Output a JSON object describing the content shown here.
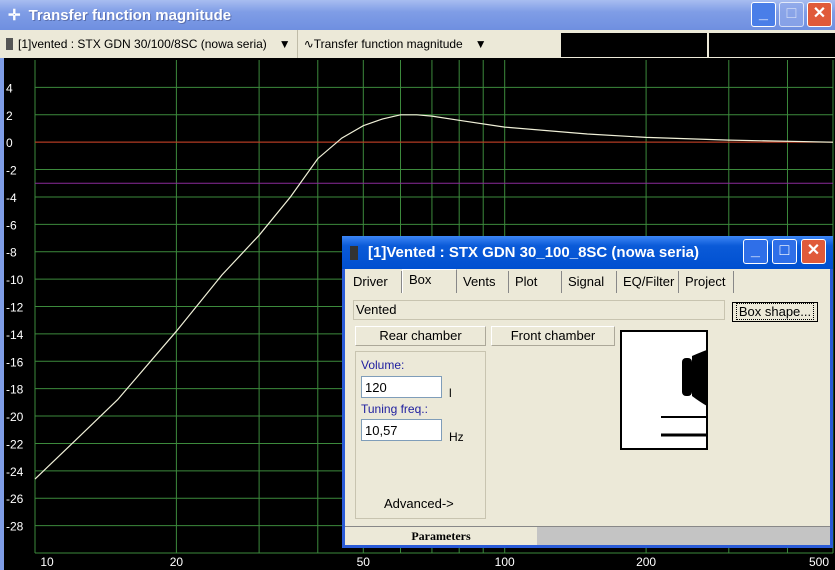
{
  "window": {
    "title": "Transfer function magnitude",
    "icon": "crosshair-icon"
  },
  "toolbar": {
    "project_select": "[1]vented : STX GDN 30/100/8SC (nowa seria)",
    "plot_select": "Transfer function magnitude"
  },
  "chart_data": {
    "type": "line",
    "title": "",
    "xlabel": "",
    "ylabel": "",
    "xscale": "log",
    "xlim": [
      10,
      500
    ],
    "ylim": [
      -30,
      6
    ],
    "grid": true,
    "x_ticks": [
      10,
      20,
      50,
      100,
      200,
      500
    ],
    "x_gridlines": [
      10,
      20,
      30,
      40,
      50,
      60,
      70,
      80,
      90,
      100,
      200,
      300,
      400,
      500
    ],
    "y_ticks": [
      4,
      2,
      0,
      -2,
      -4,
      -6,
      -8,
      -10,
      -12,
      -14,
      -16,
      -18,
      -20,
      -22,
      -24,
      -26,
      -28
    ],
    "reference_lines": [
      {
        "y": 0,
        "color": "#d03020"
      },
      {
        "y": -3,
        "color": "#8a2a9a"
      }
    ],
    "series": [
      {
        "color": "#f0f0d8",
        "x": [
          10,
          12,
          15,
          20,
          25,
          30,
          35,
          40,
          45,
          50,
          55,
          60,
          65,
          70,
          80,
          100,
          150,
          200,
          300,
          500
        ],
        "y": [
          -24.6,
          -22,
          -18.8,
          -13.8,
          -9.7,
          -6.8,
          -4,
          -1.2,
          0.3,
          1.2,
          1.7,
          2.0,
          2.0,
          1.9,
          1.6,
          1.1,
          0.6,
          0.35,
          0.15,
          0.0
        ]
      }
    ],
    "colors": {
      "background": "#000000",
      "grid": "#3c8a3c",
      "tick_text": "#ffffff"
    }
  },
  "dialog": {
    "title": "[1]Vented : STX GDN 30_100_8SC (nowa seria)",
    "tabs": [
      "Driver",
      "Box",
      "Vents",
      "Plot",
      "Signal",
      "EQ/Filter",
      "Project"
    ],
    "active_tab": "Box",
    "box_type": "Vented",
    "box_shape_button": "Box shape...",
    "rear_chamber": "Rear chamber",
    "front_chamber": "Front chamber",
    "volume_label": "Volume:",
    "volume_value": "120",
    "volume_unit": "l",
    "tuning_label": "Tuning freq.:",
    "tuning_value": "10,57",
    "tuning_unit": "Hz",
    "advanced": "Advanced->",
    "status": "Parameters"
  }
}
